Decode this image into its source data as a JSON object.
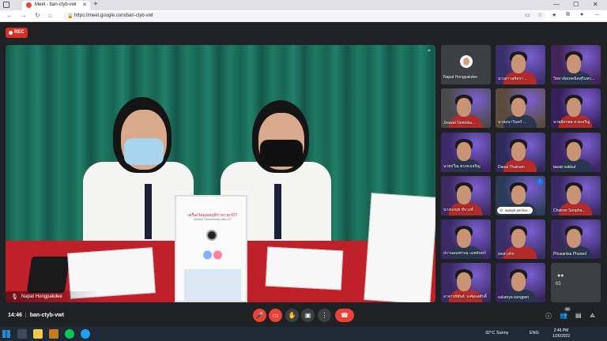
{
  "browser": {
    "tab_title": "Meet - ban-ctyb-vwt",
    "new_tab_icon": "+",
    "url": "https://meet.google.com/ban-ctyb-vwt",
    "window_controls": [
      "—",
      "☐",
      "✕"
    ]
  },
  "meet": {
    "rec_label": "REC",
    "main_speaker": "Napat Hongpakdee",
    "device_title": "เครื่องวัดอุณหภูมิร่างกาย IOT",
    "device_subtitle": "Infrared Thermometer with IOT",
    "tiles": [
      {
        "name": "Napat Hongpakdee",
        "kind": "avatar"
      },
      {
        "name": "นางสาวสุจิตรา ...",
        "kind": "video",
        "bg": "#3b2f6b"
      },
      {
        "name": "วิทยาลัยเทคนิคสุรินทร...",
        "kind": "video",
        "bg": "#42245a"
      },
      {
        "name": "Jirawat Nontrika...",
        "kind": "video",
        "bg": "#4a4a4a"
      },
      {
        "name": "นายอนาวินทร์ ...",
        "kind": "video",
        "bg": "#5a4b3a"
      },
      {
        "name": "นายอัครพล ฮวยเจริญ",
        "kind": "video",
        "bg": "#36205a"
      },
      {
        "name": "นายปวีณ ตรงจงเจริญ",
        "kind": "video",
        "bg": "#3c2a6a"
      },
      {
        "name": "Danai Thainam",
        "kind": "video",
        "bg": "#2f2a5a"
      },
      {
        "name": "tawat nakbut",
        "kind": "video",
        "bg": "#3a2461"
      },
      {
        "name": "นางนงนุช ทับวงศ์",
        "kind": "video",
        "bg": "#402a62"
      },
      {
        "name": "apaipit pechar...",
        "kind": "pinned",
        "bg": "#2b3c5a"
      },
      {
        "name": "Chatree Sonpha...",
        "kind": "video",
        "bg": "#3a2b66"
      },
      {
        "name": "ปรานอมพรรณ เฉพจันทร์",
        "kind": "video",
        "bg": "#3c2a66"
      },
      {
        "name": "soon pho",
        "kind": "video",
        "bg": "#3b2f68"
      },
      {
        "name": "Phusanisa Phuned",
        "kind": "video",
        "bg": "#38285e"
      },
      {
        "name": "อาจารย์พันธ์ วงค์ผ่องศักดิ์",
        "kind": "video",
        "bg": "#3a2a64"
      },
      {
        "name": "sukanya sungpen",
        "kind": "video",
        "bg": "#35275d"
      },
      {
        "name": "",
        "kind": "others"
      }
    ],
    "others_count": "65"
  },
  "controls": {
    "time": "14:46",
    "meeting_code": "ban-ctyb-vwt",
    "participants_badge": "62"
  },
  "taskbar": {
    "weather": "32°C  Sunny",
    "lang": "ENG",
    "time": "2:46 PM",
    "date": "1/26/2022"
  }
}
